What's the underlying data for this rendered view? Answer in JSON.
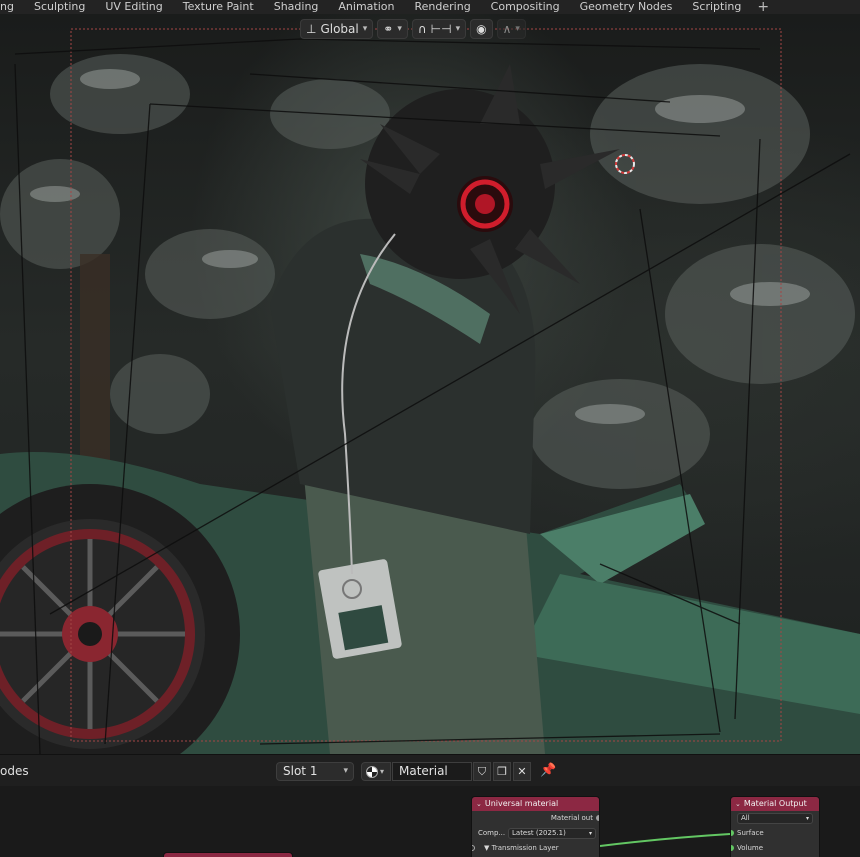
{
  "workspace_tabs": [
    "ng",
    "Sculpting",
    "UV Editing",
    "Texture Paint",
    "Shading",
    "Animation",
    "Rendering",
    "Compositing",
    "Geometry Nodes",
    "Scripting"
  ],
  "add_tab_label": "+",
  "viewport_header": {
    "transform_orientation": "Global"
  },
  "node_editor": {
    "title": "odes",
    "slot": "Slot 1",
    "material_name": "Material"
  },
  "nodes": {
    "universal_material": {
      "title": "Universal material",
      "output_label": "Material out",
      "composite_label": "Comp...",
      "version_select": "Latest (2025.1)",
      "transmission_label": "Transmission Layer"
    },
    "material_output": {
      "title": "Material Output",
      "target_select": "All",
      "surface_label": "Surface",
      "volume_label": "Volume"
    }
  },
  "colors": {
    "node_header": "#8c2843",
    "socket_green": "#63c763",
    "car_green": "#3d6b57"
  }
}
